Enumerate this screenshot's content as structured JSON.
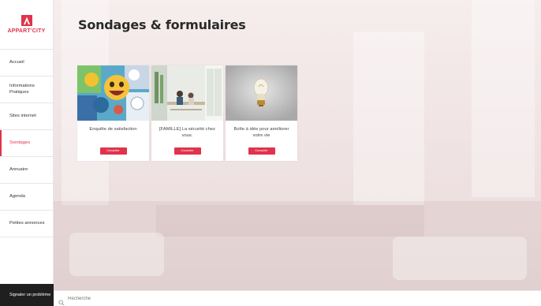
{
  "brand": {
    "name": "APPART'CITY",
    "color": "#e0334c"
  },
  "page": {
    "title": "Sondages & formulaires"
  },
  "sidebar": {
    "items": [
      {
        "label": "Accueil",
        "active": false
      },
      {
        "label": "Informations Pratiques",
        "active": false
      },
      {
        "label": "Sites internet",
        "active": false
      },
      {
        "label": "Sondages",
        "active": true
      },
      {
        "label": "Annuaire",
        "active": false
      },
      {
        "label": "Agenda",
        "active": false
      },
      {
        "label": "Petites annonces",
        "active": false
      }
    ],
    "report": "Signaler un problème"
  },
  "cards": [
    {
      "title": "Enquête de satisfaction",
      "button": "Consulter",
      "image": "emoji-mosaic-photo"
    },
    {
      "title": "[FAMILLE] La sécurité chez vous.",
      "button": "Consulter",
      "image": "family-room-photo"
    },
    {
      "title": "Boîte à idée pour améliorer votre vie",
      "button": "Consulter",
      "image": "lightbulb-photo"
    }
  ],
  "search": {
    "placeholder": "Recherche"
  }
}
